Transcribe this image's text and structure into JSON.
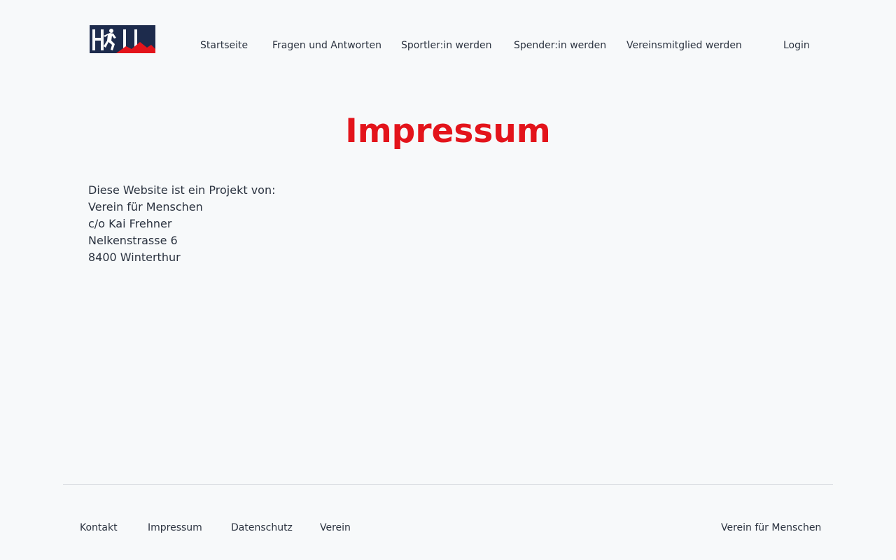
{
  "header": {
    "logo_text": "HFM",
    "nav": [
      {
        "label": "Startseite"
      },
      {
        "label": "Fragen und Antworten"
      },
      {
        "label": "Sportler:in werden"
      },
      {
        "label": "Spender:in werden"
      },
      {
        "label": "Vereinsmitglied werden"
      }
    ],
    "login_label": "Login"
  },
  "main": {
    "title": "Impressum",
    "address_lines": [
      "Diese Website ist ein Projekt von:",
      "Verein für Menschen",
      "c/o Kai Frehner",
      "Nelkenstrasse 6",
      "8400 Winterthur"
    ]
  },
  "footer": {
    "links": [
      {
        "label": "Kontakt"
      },
      {
        "label": "Impressum"
      },
      {
        "label": "Datenschutz"
      },
      {
        "label": "Verein"
      }
    ],
    "org_name": "Verein für Menschen"
  },
  "colors": {
    "accent": "#e3141b",
    "logo_navy": "#1d2b4c",
    "text": "#2b3340",
    "background": "#f7f9fa"
  }
}
